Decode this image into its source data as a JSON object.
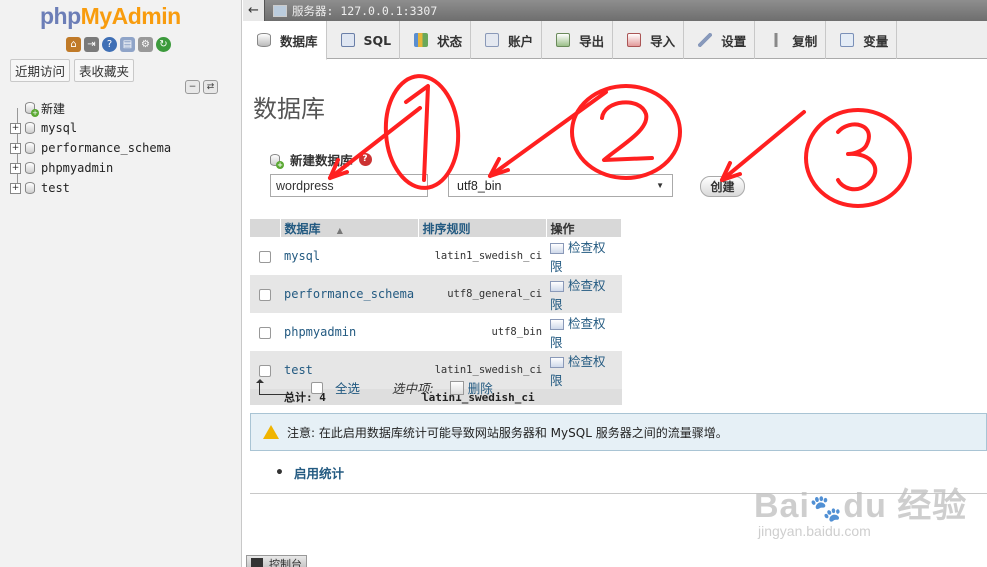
{
  "nav": {
    "logo": {
      "php": "php",
      "my": "My",
      "admin": "Admin"
    },
    "links": [
      "近期访问",
      "表收藏夹"
    ],
    "tree": [
      {
        "label": "新建",
        "type": "new"
      },
      {
        "label": "mysql",
        "type": "db"
      },
      {
        "label": "performance_schema",
        "type": "db"
      },
      {
        "label": "phpmyadmin",
        "type": "db"
      },
      {
        "label": "test",
        "type": "db"
      }
    ]
  },
  "server_bar": {
    "text": "服务器: 127.0.0.1:3307"
  },
  "tabs": [
    {
      "label": "数据库",
      "icon": "database-icon",
      "active": true
    },
    {
      "label": "SQL",
      "icon": "sql-icon"
    },
    {
      "label": "状态",
      "icon": "status-icon"
    },
    {
      "label": "账户",
      "icon": "users-icon"
    },
    {
      "label": "导出",
      "icon": "export-icon"
    },
    {
      "label": "导入",
      "icon": "import-icon"
    },
    {
      "label": "设置",
      "icon": "wrench-icon"
    },
    {
      "label": "复制",
      "icon": "replication-icon"
    },
    {
      "label": "变量",
      "icon": "variables-icon"
    }
  ],
  "page": {
    "title": "数据库"
  },
  "create": {
    "label": "新建数据库",
    "name_value": "wordpress",
    "collation_value": "utf8_bin",
    "button_label": "创建"
  },
  "table": {
    "headers": {
      "database": "数据库",
      "collation": "排序规则",
      "action": "操作"
    },
    "rows": [
      {
        "name": "mysql",
        "collation": "latin1_swedish_ci",
        "action": "检查权限"
      },
      {
        "name": "performance_schema",
        "collation": "utf8_general_ci",
        "action": "检查权限"
      },
      {
        "name": "phpmyadmin",
        "collation": "utf8_bin",
        "action": "检查权限"
      },
      {
        "name": "test",
        "collation": "latin1_swedish_ci",
        "action": "检查权限"
      }
    ],
    "total_label": "总计: 4",
    "total_collation": "latin1_swedish_ci"
  },
  "actions": {
    "select_all": "全选",
    "with_selected": "选中项:",
    "delete": "删除"
  },
  "notice": {
    "text": "注意: 在此启用数据库统计可能导致网站服务器和 MySQL 服务器之间的流量骤增。"
  },
  "enable_stats": "启用统计",
  "console": "控制台",
  "annotations": {
    "marks": [
      "1",
      "2",
      "3"
    ],
    "color": "#ff2020"
  },
  "watermark": {
    "brand": "Bai",
    "brand2": "du",
    "brand3": "经验",
    "url": "jingyan.baidu.com"
  },
  "colors": {
    "link": "#235a81",
    "notice_bg": "#e6f0f6",
    "logo_php": "#6c7eb7",
    "logo_myadmin": "#f89c0e"
  }
}
